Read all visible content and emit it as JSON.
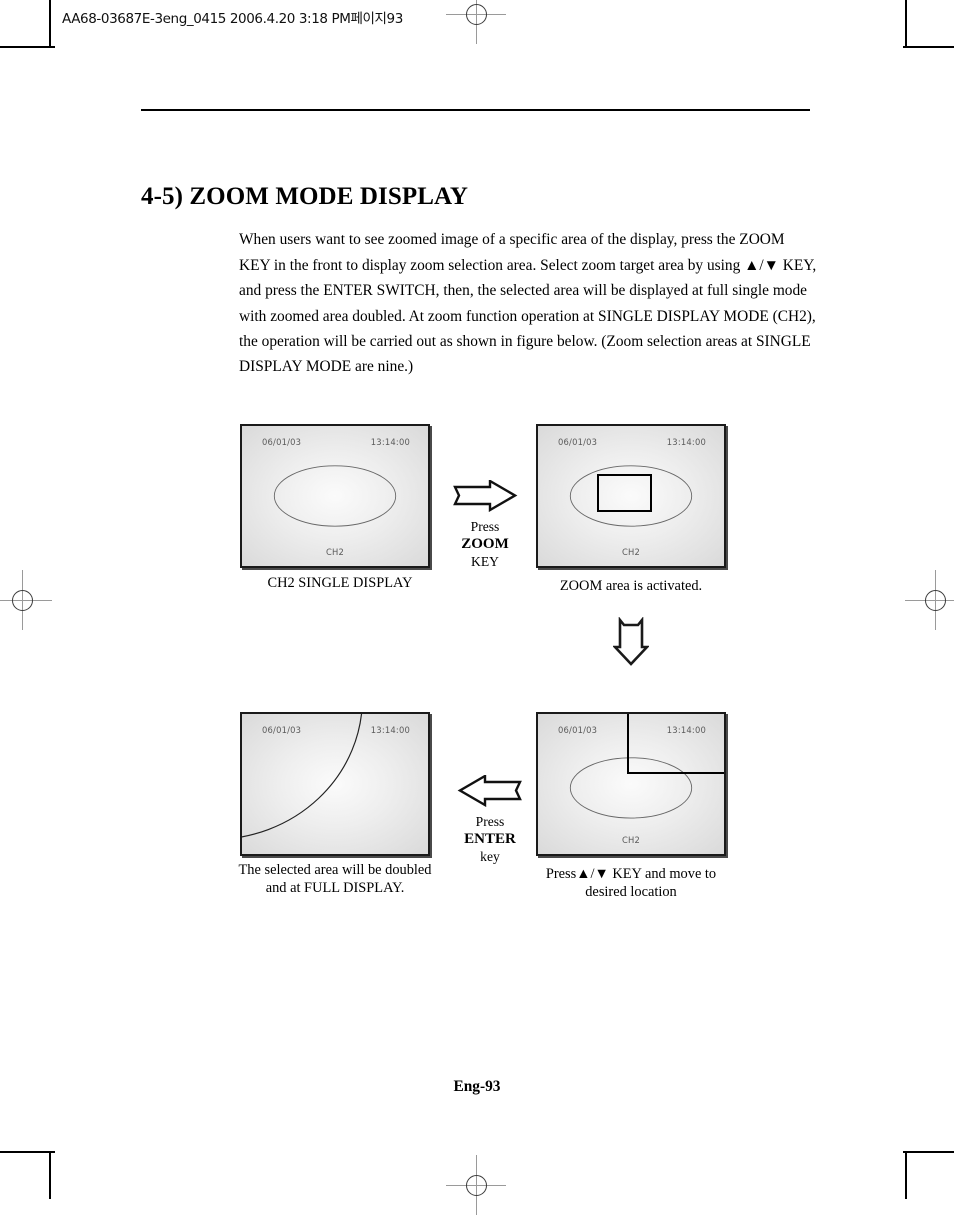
{
  "film_header": "AA68-03687E-3eng_0415  2006.4.20 3:18 PM페이지93",
  "section": {
    "title": "4-5) ZOOM MODE DISPLAY",
    "body": "When users want to see zoomed image of a specific area of the display, press the ZOOM KEY in the front to display zoom selection area. Select zoom target area by using ▲/▼ KEY, and press the ENTER SWITCH, then, the selected area will be displayed at full single mode with zoomed area doubled. At zoom function operation at SINGLE DISPLAY MODE (CH2), the operation will be carried out as shown in figure below. (Zoom selection areas at SINGLE DISPLAY MODE are nine.)"
  },
  "panels": {
    "top_left": {
      "osd_date": "06/01/03",
      "osd_time": "13:14:00",
      "osd_channel": "CH2",
      "caption": "CH2 SINGLE DISPLAY"
    },
    "top_right": {
      "osd_date": "06/01/03",
      "osd_time": "13:14:00",
      "osd_channel": "CH2",
      "caption": "ZOOM area is activated."
    },
    "bottom_right": {
      "osd_date": "06/01/03",
      "osd_time": "13:14:00",
      "osd_channel": "CH2",
      "caption": "Press▲/▼ KEY  and move to\ndesired location"
    },
    "bottom_left": {
      "osd_date": "06/01/03",
      "osd_time": "13:14:00",
      "caption": "The selected area will be doubled\nand at FULL DISPLAY."
    }
  },
  "arrows": {
    "zoom_key": {
      "direction": "right",
      "label_line1_prefix": "Press ",
      "label_line1_bold": "ZOOM",
      "label_line2": "KEY"
    },
    "down": {
      "direction": "down"
    },
    "enter_key": {
      "direction": "left",
      "label_line1_prefix": "Press  ",
      "label_line1_bold": "ENTER",
      "label_line2": "key"
    }
  },
  "footer": "Eng-93",
  "colors": {
    "ink": "#000000",
    "panel_border": "#1a1a1a",
    "panel_fill_light": "#fbfbfb",
    "panel_fill_dark": "#d9d9d9",
    "osd_text": "#5b5b5b",
    "reg_mark": "#9a9a9a"
  }
}
